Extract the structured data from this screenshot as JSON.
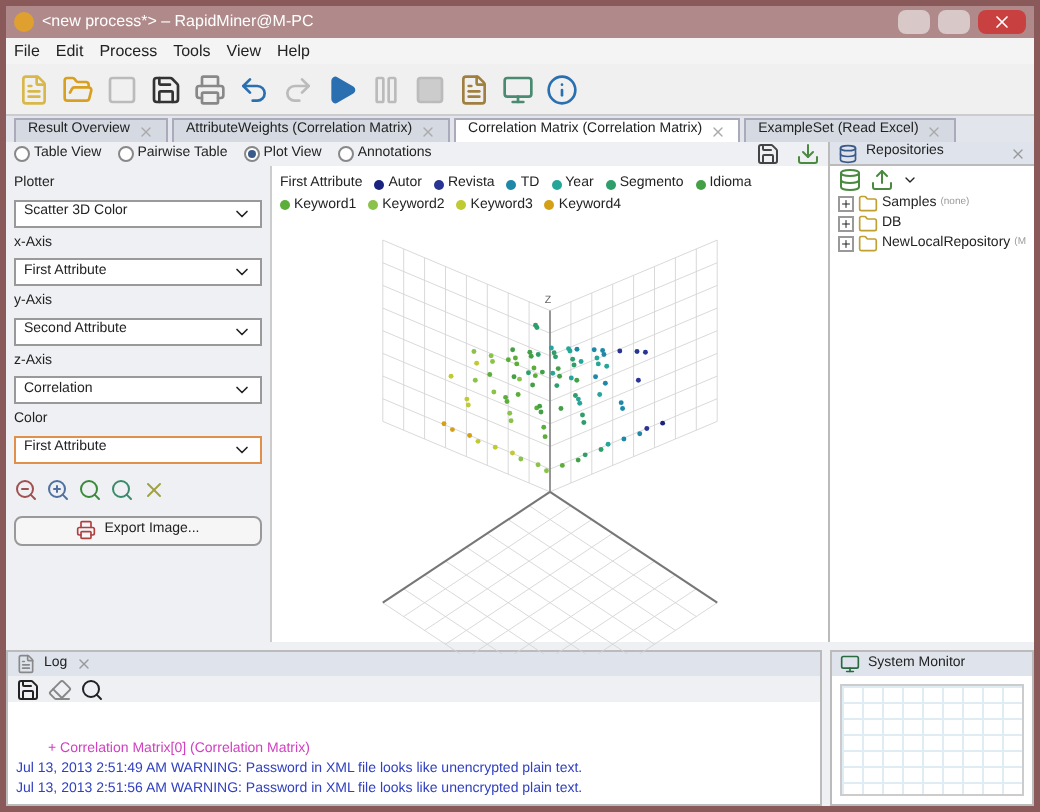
{
  "window": {
    "title": "<new process*> – RapidMiner@M-PC"
  },
  "menu": [
    "File",
    "Edit",
    "Process",
    "Tools",
    "View",
    "Help"
  ],
  "tabs": [
    {
      "label": "Result Overview",
      "selected": false
    },
    {
      "label": "AttributeWeights (Correlation Matrix)",
      "selected": false
    },
    {
      "label": "Correlation Matrix (Correlation Matrix)",
      "selected": true
    },
    {
      "label": "ExampleSet (Read Excel)",
      "selected": false
    }
  ],
  "views": [
    {
      "label": "Table View",
      "selected": false
    },
    {
      "label": "Pairwise Table",
      "selected": false
    },
    {
      "label": "Plot View",
      "selected": true
    },
    {
      "label": "Annotations",
      "selected": false
    }
  ],
  "settings": [
    {
      "label": "Plotter",
      "value": "Scatter 3D Color",
      "focused": false
    },
    {
      "label": "x-Axis",
      "value": "First Attribute",
      "focused": false
    },
    {
      "label": "y-Axis",
      "value": "Second Attribute",
      "focused": false
    },
    {
      "label": "z-Axis",
      "value": "Correlation",
      "focused": false
    },
    {
      "label": "Color",
      "value": "First Attribute",
      "focused": true
    }
  ],
  "export_button": "Export Image...",
  "legend": {
    "title": "First Attribute",
    "items": [
      {
        "label": "Autor",
        "color": "#1a237e"
      },
      {
        "label": "Revista",
        "color": "#283593"
      },
      {
        "label": "TD",
        "color": "#1e88a8"
      },
      {
        "label": "Year",
        "color": "#26a69a"
      },
      {
        "label": "Segmento",
        "color": "#2e9e6a"
      },
      {
        "label": "Idioma",
        "color": "#43a047"
      },
      {
        "label": "Keyword1",
        "color": "#5cae3a"
      },
      {
        "label": "Keyword2",
        "color": "#8bc34a"
      },
      {
        "label": "Keyword3",
        "color": "#c0ca33"
      },
      {
        "label": "Keyword4",
        "color": "#d4a017"
      }
    ]
  },
  "plot": {
    "axis_label": "Z"
  },
  "repositories": {
    "title": "Repositories",
    "items": [
      {
        "label": "Samples",
        "note": "(none)"
      },
      {
        "label": "DB"
      },
      {
        "label": "NewLocalRepository",
        "note": "(M"
      }
    ]
  },
  "log": {
    "title": "Log",
    "lines": [
      {
        "kind": "result",
        "text": "+ Correlation Matrix[0] (Correlation Matrix)"
      },
      {
        "kind": "warning",
        "text": "Jul 13, 2013 2:51:49 AM WARNING: Password in XML file looks like unencrypted plain text."
      },
      {
        "kind": "warning",
        "text": "Jul 13, 2013 2:51:56 AM WARNING: Password in XML file looks like unencrypted plain text."
      }
    ]
  },
  "system_monitor": {
    "title": "System Monitor"
  }
}
